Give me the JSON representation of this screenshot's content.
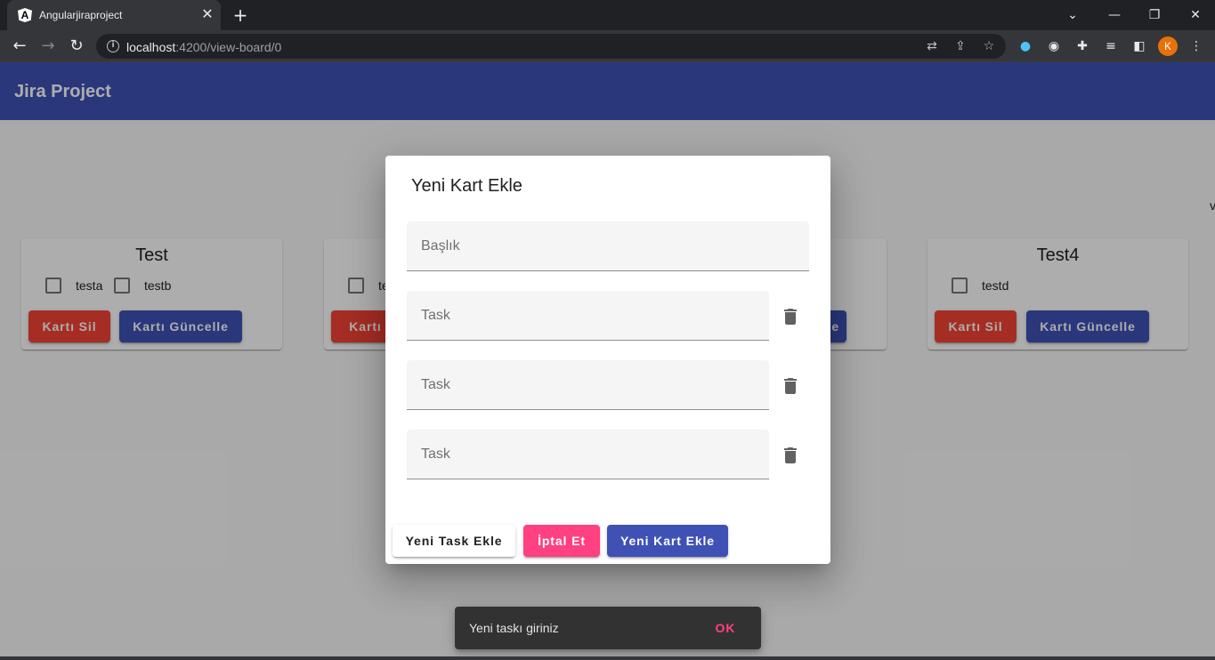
{
  "browser": {
    "tab_title": "Angularjiraproject",
    "tab_favicon": "A",
    "url_host": "localhost",
    "url_path": ":4200/view-board/0",
    "profile_initial": "K",
    "icons": [
      "back-icon",
      "forward-icon",
      "reload-icon",
      "info-icon",
      "translate-icon",
      "share-icon",
      "star-icon",
      "extensions-icon",
      "side-panel-icon",
      "menu-icon"
    ]
  },
  "app": {
    "title": "Jira Project",
    "edge_text": "v"
  },
  "cards": [
    {
      "title": "Test",
      "tasks": [
        "testa",
        "testb"
      ],
      "delete_label": "Kartı Sil",
      "update_label": "Kartı Güncelle"
    },
    {
      "title": "",
      "tasks": [
        "te"
      ],
      "delete_label": "Kartı S",
      "update_label": ""
    },
    {
      "title": "",
      "tasks": [],
      "delete_label": "",
      "update_label": "e"
    },
    {
      "title": "Test4",
      "tasks": [
        "testd"
      ],
      "delete_label": "Kartı Sil",
      "update_label": "Kartı Güncelle"
    }
  ],
  "dialog": {
    "title": "Yeni Kart Ekle",
    "title_placeholder": "Başlık",
    "task_placeholders": [
      "Task",
      "Task",
      "Task"
    ],
    "add_task_label": "Yeni Task Ekle",
    "cancel_label": "İptal Et",
    "submit_label": "Yeni Kart Ekle"
  },
  "snackbar": {
    "message": "Yeni taskı giriniz",
    "action": "OK"
  },
  "colors": {
    "primary": "#3f51b5",
    "accent": "#ff4081",
    "warn": "#f44336"
  }
}
